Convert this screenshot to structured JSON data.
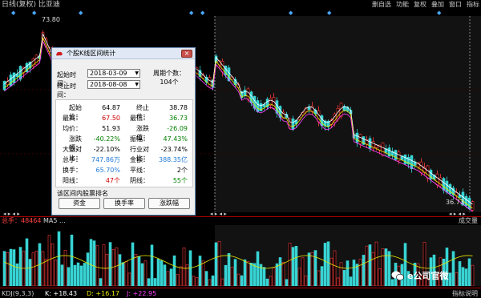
{
  "header": {
    "title": "日线(复权) 比亚迪",
    "tools": [
      "删自选",
      "功能",
      "复权",
      "叠加",
      "窗口",
      "指标"
    ]
  },
  "colors": {
    "up": "#ff3b3b",
    "down": "#38d4d4",
    "ma_white": "#ffffff",
    "ma_yellow": "#e8e800",
    "ma_magenta": "#ff40ff",
    "accent_blue": "#4aa8ff"
  },
  "price_labels": {
    "high": "73.80",
    "low": "36.73"
  },
  "mid_strip": {
    "markers": "◂ ▸ ◂ ▸"
  },
  "volume": {
    "label": "总手：48464",
    "label2": "MA5 ...",
    "right": "成交量"
  },
  "kdj": {
    "name": "KDJ(9,3,3)",
    "k": "K: +18.43",
    "d": "D: +16.17",
    "j": "J: +22.95",
    "right": "指标说明"
  },
  "watermark": {
    "text": "e公司官微"
  },
  "dialog": {
    "title": "个股K线区间统计",
    "start_label": "起始时间：",
    "start_value": "2018-03-09",
    "end_label": "终止时间：",
    "end_value": "2018-08-08",
    "period_label": "周期个数：",
    "period_value": "104个",
    "stats": [
      {
        "k": "起始价：",
        "v": "64.87",
        "color": "#000000"
      },
      {
        "k": "终止价：",
        "v": "38.78",
        "color": "#000000"
      },
      {
        "k": "最高：",
        "v": "67.50",
        "color": "#d00000"
      },
      {
        "k": "最低：",
        "v": "36.73",
        "color": "#008000"
      },
      {
        "k": "均价：",
        "v": "51.93",
        "color": "#000000"
      },
      {
        "k": "涨跌值：",
        "v": "-26.09",
        "color": "#008000"
      },
      {
        "k": "涨跌幅：",
        "v": "-40.22%",
        "color": "#008000"
      },
      {
        "k": "振幅：",
        "v": "47.43%",
        "color": "#008000"
      },
      {
        "k": "大盘对比：",
        "v": "-22.10%",
        "color": "#000000"
      },
      {
        "k": "行业对比：",
        "v": "-23.74%",
        "color": "#000000"
      },
      {
        "k": "总手：",
        "v": "747.86万",
        "color": "#1f7ad8"
      },
      {
        "k": "金额：",
        "v": "388.35亿",
        "color": "#1f7ad8"
      },
      {
        "k": "换手：",
        "v": "65.70%",
        "color": "#1f7ad8"
      },
      {
        "k": "平线：",
        "v": "2个",
        "color": "#000000"
      },
      {
        "k": "阳线：",
        "v": "47个",
        "color": "#d00000"
      },
      {
        "k": "阴线：",
        "v": "55个",
        "color": "#008000"
      }
    ],
    "section_title": "该区间内股票排名",
    "buttons": [
      "资金",
      "换手率",
      "涨跌幅"
    ]
  }
}
